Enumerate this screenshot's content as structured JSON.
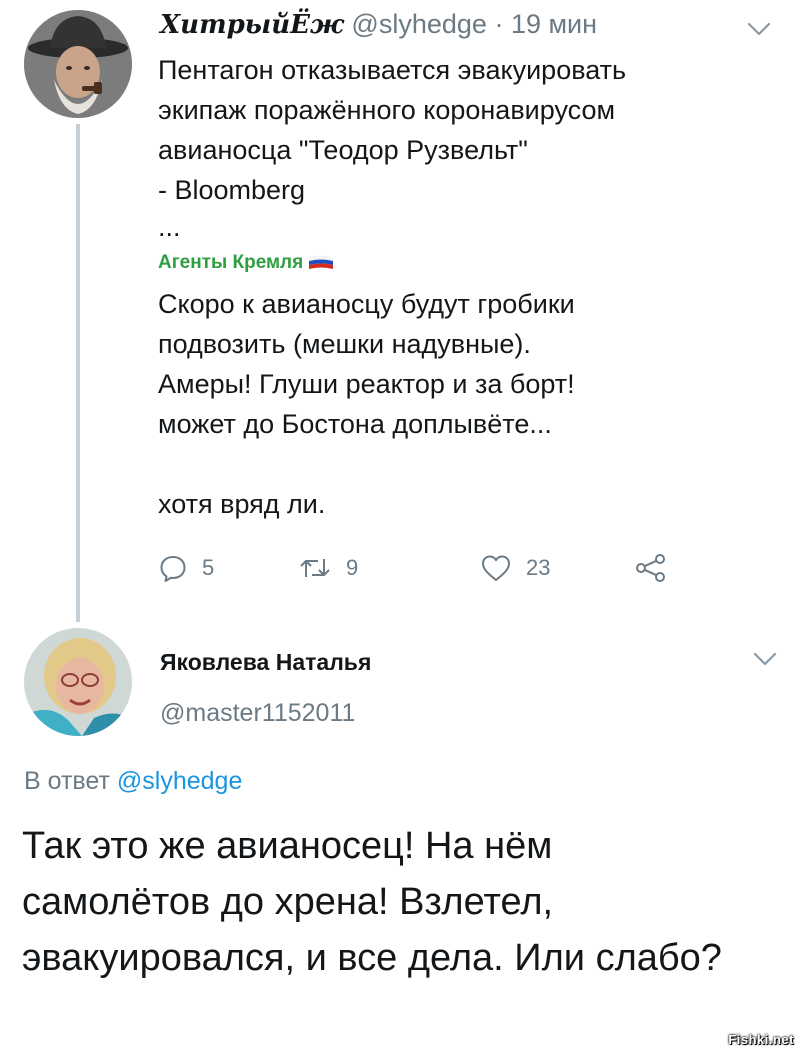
{
  "tweet": {
    "author": {
      "display_name": "ХитрыйЁж",
      "handle": "@slyhedge",
      "separator": "·",
      "time": "19 мин"
    },
    "body_lines": [
      "Пентагон отказывается эвакуировать",
      "экипаж поражённого коронавирусом",
      "авианосца \"Теодор Рузвельт\"",
      "- Bloomberg"
    ],
    "ellipsis": "...",
    "quoted_author": "Агенты Кремля",
    "quote_lines": [
      "Скоро к авианосцу будут гробики",
      "подвозить (мешки надувные).",
      "Амеры! Глуши реактор и за борт!",
      "может до Бостона доплывёте..."
    ],
    "quote_last": "хотя вряд ли.",
    "actions": {
      "replies": "5",
      "retweets": "9",
      "likes": "23"
    }
  },
  "reply": {
    "author": {
      "display_name": "Яковлева Наталья",
      "handle": "@master1152011"
    },
    "reply_to_label": "В ответ",
    "reply_to_handle": "@slyhedge",
    "text": "Так это же авианосец! На нём самолётов до хрена! Взлетел, эвакуировался, и все дела. Или слабо?"
  },
  "watermark": "Fishki.net",
  "colors": {
    "text": "#14171a",
    "secondary": "#6b7a85",
    "mention": "#1b95e0",
    "tag_green": "#2f9e3f",
    "thread_line": "#c6cfd6"
  },
  "icons": [
    "reply-icon",
    "retweet-icon",
    "like-icon",
    "share-icon",
    "chevron-down-icon",
    "russian-flag-icon"
  ]
}
